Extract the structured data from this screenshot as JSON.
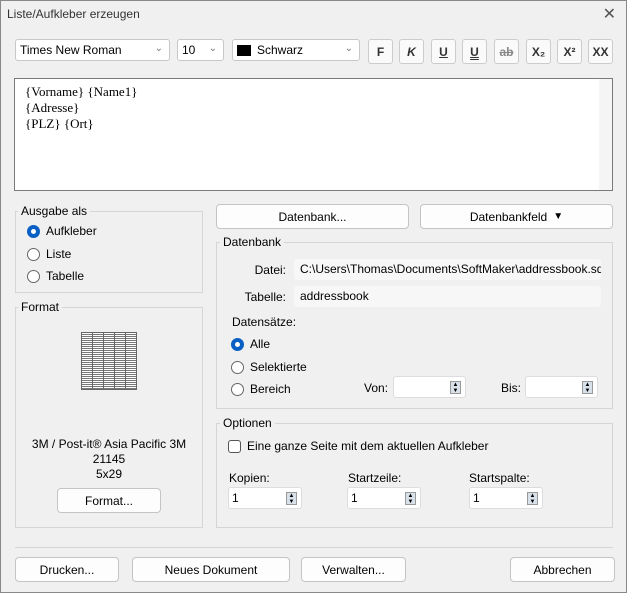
{
  "window": {
    "title": "Liste/Aufkleber erzeugen",
    "close": "✕"
  },
  "toolbar": {
    "font": "Times New Roman",
    "size": "10",
    "color_name": "Schwarz",
    "color_swatch": "#000000",
    "buttons": [
      "F",
      "K",
      "U",
      "U",
      "ab",
      "X₂",
      "X²",
      "XX"
    ]
  },
  "editor": {
    "lines": [
      "{Vorname} {Name1}",
      "{Adresse}",
      "{PLZ} {Ort}"
    ]
  },
  "output": {
    "label": "Ausgabe als",
    "options": [
      "Aufkleber",
      "Liste",
      "Tabelle"
    ],
    "selected": 0
  },
  "format": {
    "label": "Format",
    "line1": "3M / Post-it®  Asia Pacific 3M",
    "line2": "21145",
    "line3": "5x29",
    "button": "Format..."
  },
  "db_buttons": {
    "database": "Datenbank...",
    "field": "Datenbankfeld"
  },
  "database": {
    "label": "Datenbank",
    "file_label": "Datei:",
    "file": "C:\\Users\\Thomas\\Documents\\SoftMaker\\addressbook.sq",
    "table_label": "Tabelle:",
    "table": "addressbook",
    "records_label": "Datensätze:",
    "records": [
      "Alle",
      "Selektierte",
      "Bereich"
    ],
    "selected": 0,
    "from_label": "Von:",
    "from": "",
    "to_label": "Bis:",
    "to": ""
  },
  "options": {
    "label": "Optionen",
    "checkbox": "Eine ganze Seite mit dem aktuellen Aufkleber",
    "checked": false,
    "copies_label": "Kopien:",
    "copies": "1",
    "start_row_label": "Startzeile:",
    "start_row": "1",
    "start_col_label": "Startspalte:",
    "start_col": "1"
  },
  "footer": {
    "print": "Drucken...",
    "new_doc": "Neues Dokument",
    "manage": "Verwalten...",
    "cancel": "Abbrechen"
  }
}
